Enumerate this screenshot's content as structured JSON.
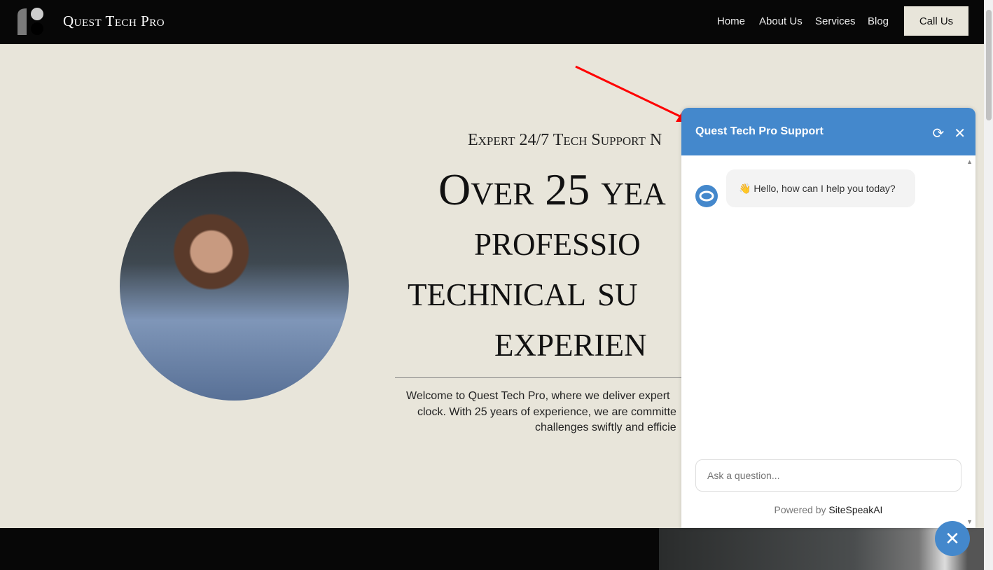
{
  "nav": {
    "brand": "Quest Tech Pro",
    "items": [
      "Home",
      "About Us",
      "Services",
      "Blog"
    ],
    "cta": "Call Us"
  },
  "hero": {
    "subtitle": "Expert 24/7 Tech Support N",
    "heading_lines": [
      "Over 25 yea",
      "professio",
      "technical su",
      "experien"
    ],
    "paragraph_lines": [
      "Welcome to Quest Tech Pro, where we deliver expert",
      "clock. With 25 years of experience, we are committe",
      "challenges swiftly and efficie"
    ]
  },
  "chat": {
    "title": "Quest Tech Pro Support",
    "greeting": "👋 Hello, how can I help you today?",
    "input_placeholder": "Ask a question...",
    "powered_prefix": "Powered by",
    "powered_brand": "SiteSpeakAI",
    "accent": "#4488cc"
  }
}
